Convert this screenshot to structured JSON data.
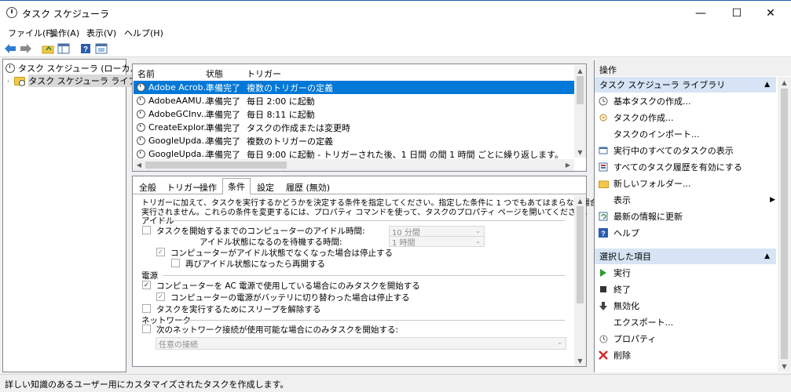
{
  "window": {
    "title": "タスク スケジューラ",
    "controls": {
      "minimize": "—",
      "maximize": "☐",
      "close": "✕"
    }
  },
  "menu": [
    "ファイル(F)",
    "操作(A)",
    "表示(V)",
    "ヘルプ(H)"
  ],
  "toolbar": [
    "back-arrow-icon",
    "forward-arrow-icon",
    "up-folder-icon",
    "show-hide-console-tree-icon",
    "help-icon",
    "properties-icon"
  ],
  "tree": {
    "root": "タスク スケジューラ (ローカル)",
    "child": "タスク スケジューラ ライブラリ"
  },
  "task_list": {
    "columns": [
      "名前",
      "状態",
      "トリガー"
    ],
    "rows": [
      {
        "name": "Adobe Acrob...",
        "status": "準備完了",
        "trigger": "複数のトリガーの定義"
      },
      {
        "name": "AdobeAAMU...",
        "status": "準備完了",
        "trigger": "毎日 2:00 に起動"
      },
      {
        "name": "AdobeGCInv...",
        "status": "準備完了",
        "trigger": "毎日 8:11 に起動"
      },
      {
        "name": "CreateExplor...",
        "status": "準備完了",
        "trigger": "タスクの作成または変更時"
      },
      {
        "name": "GoogleUpda...",
        "status": "準備完了",
        "trigger": "複数のトリガーの定義"
      },
      {
        "name": "GoogleUpda...",
        "status": "準備完了",
        "trigger": "毎日 9:00 に起動 - トリガーされた後、1 日間 の間 1 時間 ごとに繰り返します。"
      }
    ]
  },
  "detail": {
    "tabs": [
      "全般",
      "トリガー",
      "操作",
      "条件",
      "設定",
      "履歴 (無効)"
    ],
    "active_tab": "条件",
    "intro_line1": "トリガーに加えて、タスクを実行するかどうかを決定する条件を指定してください。指定した条件に 1 つでもあてはまらない場合、タスクは",
    "intro_line2": "実行されません。これらの条件を変更するには、プロパティ コマンドを使って、タスクのプロパティ ページを開いてください。",
    "idle_section": "アイドル",
    "idle_start": "タスクを開始するまでのコンピューターのアイドル時間:",
    "idle_start_value": "10 分間",
    "idle_wait": "アイドル状態になるのを待機する時間:",
    "idle_wait_value": "1 時間",
    "idle_stop": "コンピューターがアイドル状態でなくなった場合は停止する",
    "idle_restart": "再びアイドル状態になったら再開する",
    "power_section": "電源",
    "power_ac": "コンピューターを AC 電源で使用している場合にのみタスクを開始する",
    "power_battery": "コンピューターの電源がバッテリに切り替わった場合は停止する",
    "power_wake": "タスクを実行するためにスリープを解除する",
    "network_section": "ネットワーク",
    "network_only": "次のネットワーク接続が使用可能な場合にのみタスクを開始する:",
    "network_value": "任意の接続"
  },
  "actions": {
    "header": "操作",
    "group1": "タスク スケジューラ ライブラリ",
    "items1": [
      {
        "label": "基本タスクの作成...",
        "icon": "wizard-icon"
      },
      {
        "label": "タスクの作成...",
        "icon": "create-task-icon"
      },
      {
        "label": "タスクのインポート...",
        "icon": ""
      },
      {
        "label": "実行中のすべてのタスクの表示",
        "icon": "running-tasks-icon"
      },
      {
        "label": "すべてのタスク履歴を有効にする",
        "icon": "history-icon"
      },
      {
        "label": "新しいフォルダー...",
        "icon": "new-folder-icon"
      },
      {
        "label": "表示",
        "icon": ""
      },
      {
        "label": "最新の情報に更新",
        "icon": "refresh-icon"
      },
      {
        "label": "ヘルプ",
        "icon": "help-icon"
      }
    ],
    "group2": "選択した項目",
    "items2": [
      {
        "label": "実行",
        "icon": "run-icon"
      },
      {
        "label": "終了",
        "icon": "end-icon"
      },
      {
        "label": "無効化",
        "icon": "disable-icon"
      },
      {
        "label": "エクスポート...",
        "icon": ""
      },
      {
        "label": "プロパティ",
        "icon": "properties-icon"
      },
      {
        "label": "削除",
        "icon": "delete-icon"
      }
    ]
  },
  "status_bar": "詳しい知識のあるユーザー用にカスタマイズされたタスクを作成します。",
  "colors": {
    "selection": "#0078d7",
    "group_header": "#d6e4f5",
    "accent_border": "#1e5fa8"
  }
}
